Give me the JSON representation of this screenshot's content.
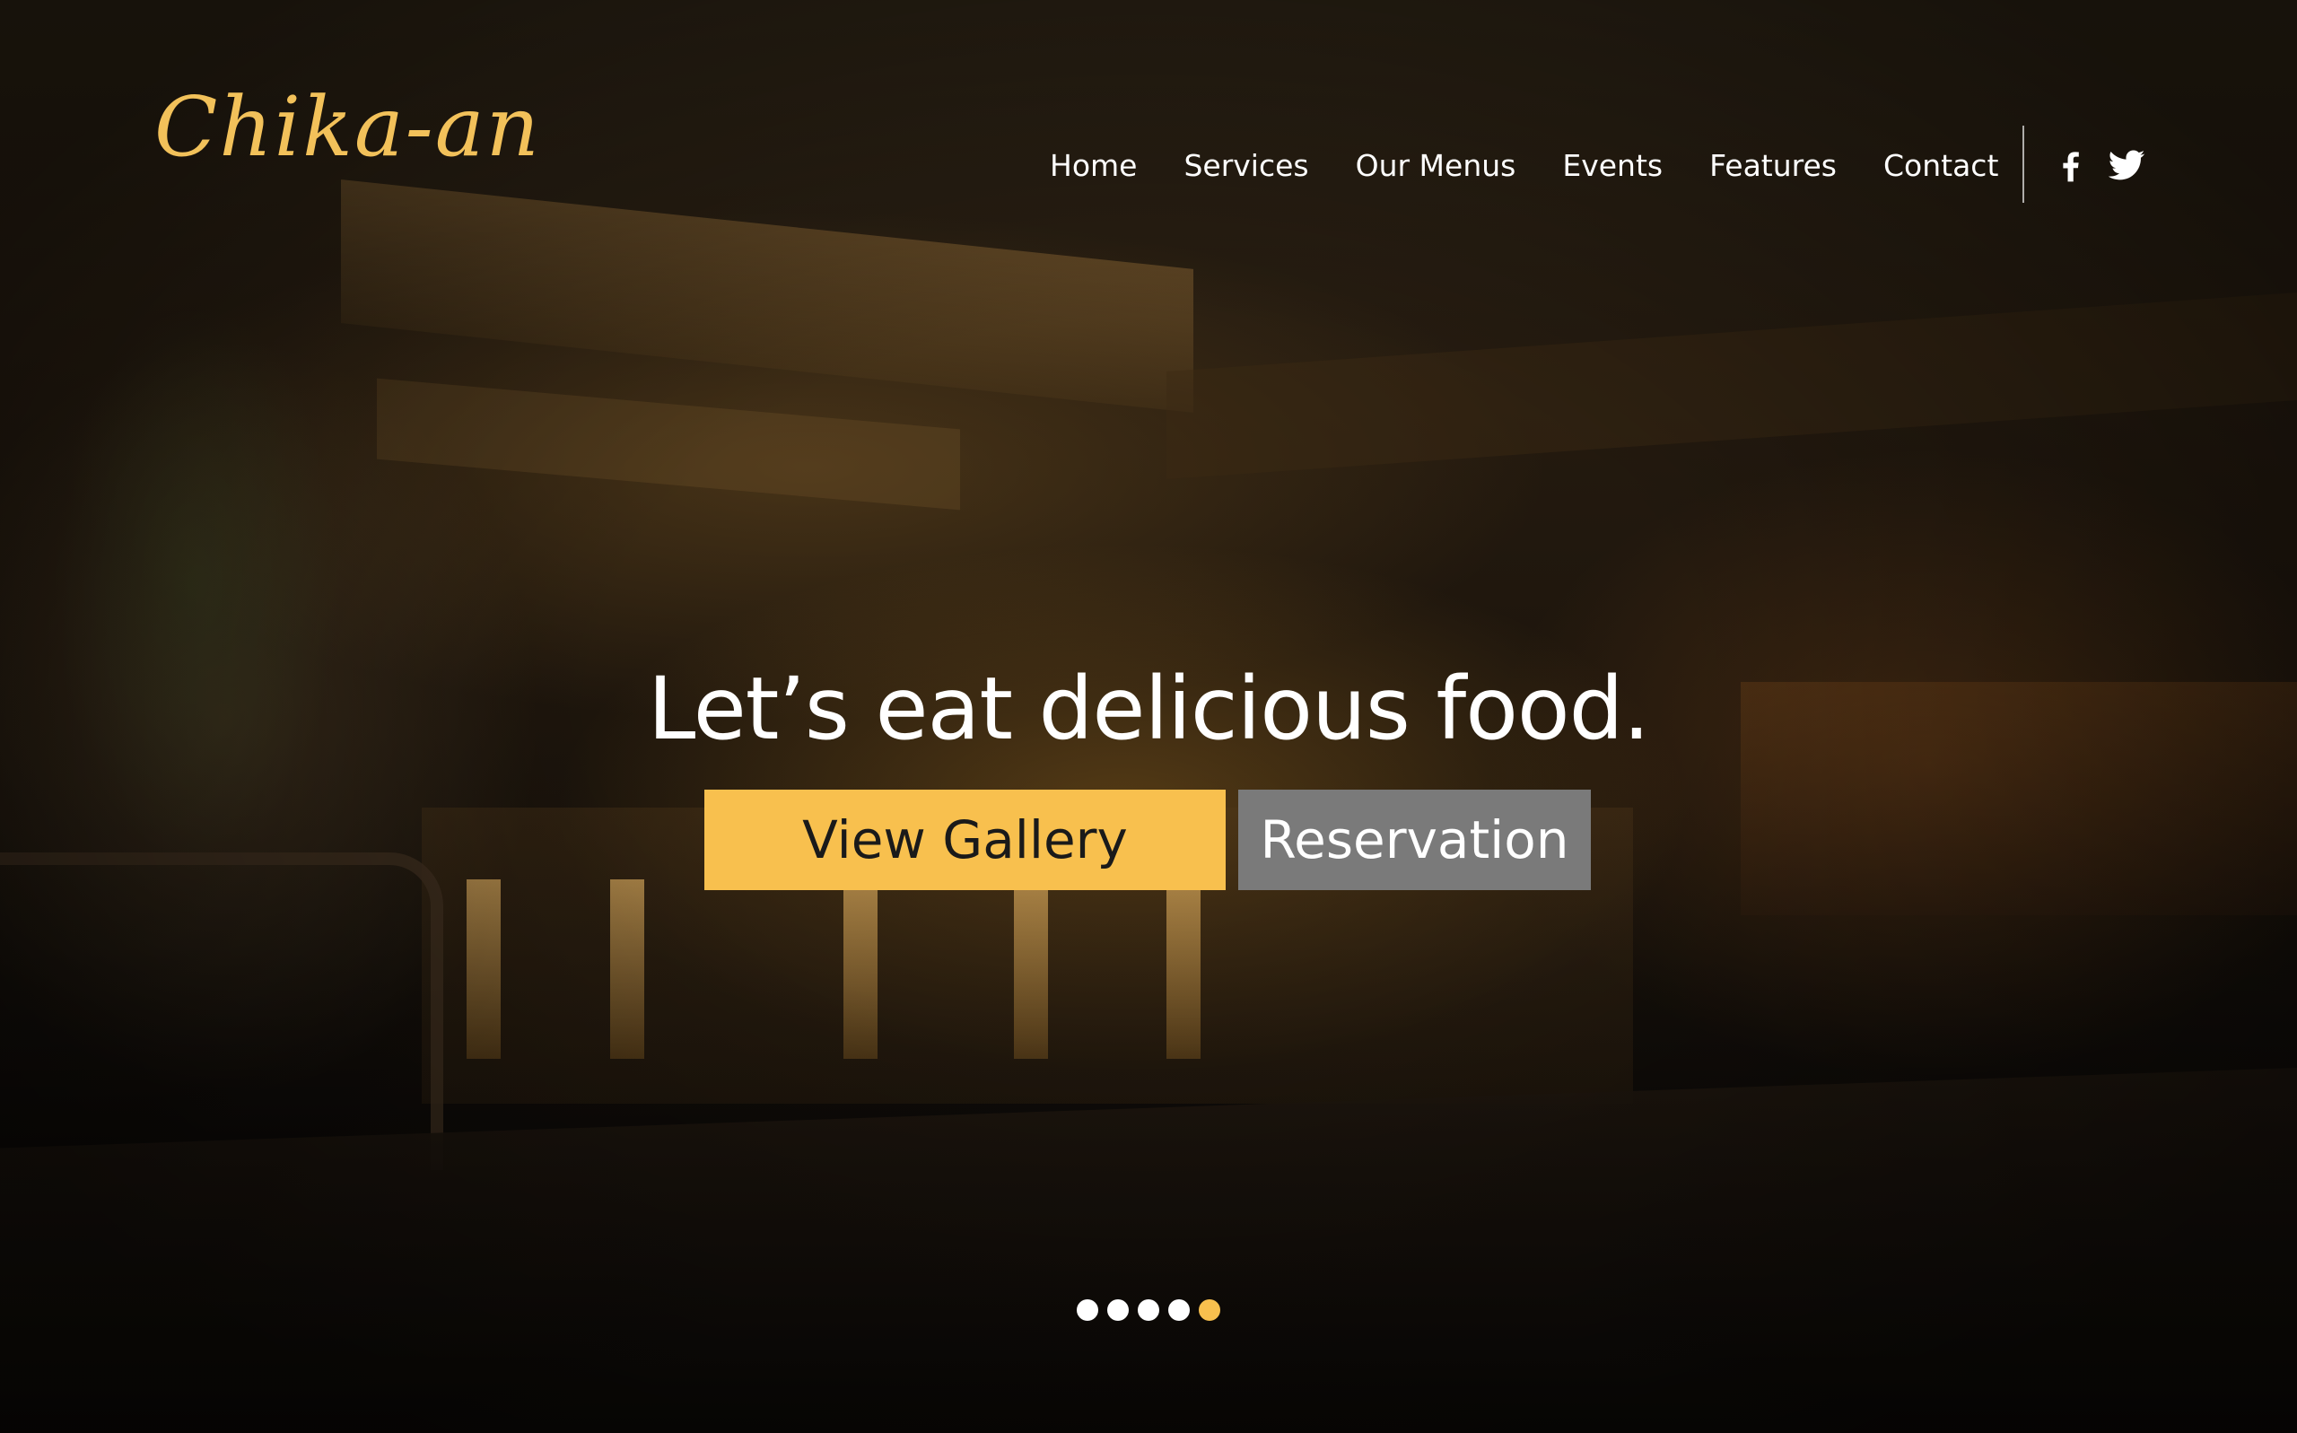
{
  "brand": {
    "logo_text": "Chika-an",
    "accent_color": "#f8c04e"
  },
  "nav": {
    "items": [
      {
        "label": "Home"
      },
      {
        "label": "Services"
      },
      {
        "label": "Our Menus"
      },
      {
        "label": "Events"
      },
      {
        "label": "Features"
      },
      {
        "label": "Contact"
      }
    ],
    "social": [
      {
        "icon": "facebook-icon"
      },
      {
        "icon": "twitter-icon"
      }
    ]
  },
  "hero": {
    "headline": "Let’s eat delicious food.",
    "primary_button": "View Gallery",
    "primary_color": "#f8c04e",
    "secondary_button": "Reservation",
    "secondary_color": "#7a7a7a",
    "slider": {
      "total": 5,
      "active": 5
    }
  }
}
